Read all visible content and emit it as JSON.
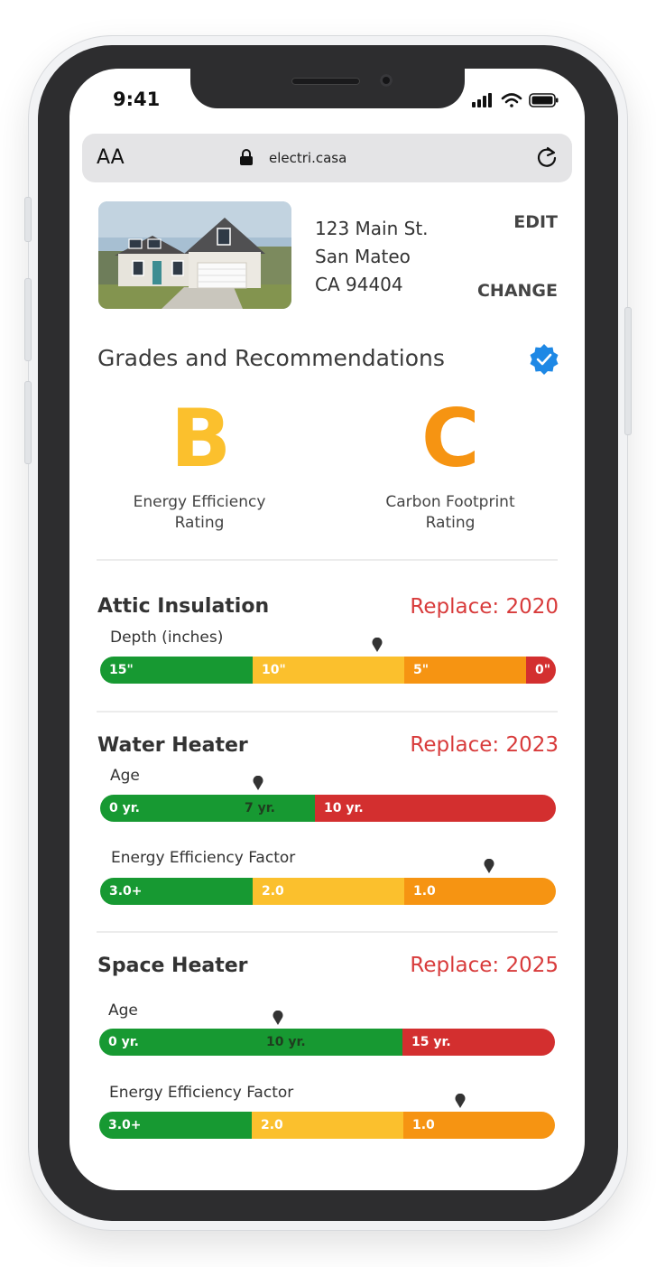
{
  "status_bar": {
    "time": "9:41"
  },
  "browser": {
    "text_size": "AA",
    "url": "electri.casa"
  },
  "property": {
    "address_line1": "123 Main St.",
    "address_line2": "San Mateo",
    "address_line3": "CA 94404",
    "edit_label": "EDIT",
    "change_label": "CHANGE"
  },
  "grades": {
    "heading": "Grades and Recommendations",
    "energy": {
      "letter": "B",
      "label_line1": "Energy Efficiency",
      "label_line2": "Rating",
      "color": "#FBC02D"
    },
    "carbon": {
      "letter": "C",
      "label_line1": "Carbon Footprint",
      "label_line2": "Rating",
      "color": "#F69412"
    }
  },
  "colors": {
    "green": "#179932",
    "yellow": "#FBC02D",
    "orange": "#F69412",
    "red": "#D32F2F",
    "replace_text": "#D83B3B",
    "verified": "#1E88E5"
  },
  "attic": {
    "title": "Attic Insulation",
    "replace": "Replace: 2020",
    "depth_label": "Depth (inches)",
    "segments": [
      "15\"",
      "10\"",
      "5\"",
      "0\""
    ]
  },
  "water_heater": {
    "title": "Water Heater",
    "replace": "Replace: 2023",
    "age_label": "Age",
    "age_segments": [
      "0 yr.",
      "7 yr.",
      "10 yr."
    ],
    "efficiency_label": "Energy Efficiency Factor",
    "efficiency_segments": [
      "3.0+",
      "2.0",
      "1.0"
    ]
  },
  "space_heater": {
    "title": "Space Heater",
    "replace": "Replace: 2025",
    "age_label": "Age",
    "age_segments": [
      "0 yr.",
      "10 yr.",
      "15 yr."
    ],
    "efficiency_label": "Energy Efficiency Factor",
    "efficiency_segments": [
      "3.0+",
      "2.0",
      "1.0"
    ]
  }
}
